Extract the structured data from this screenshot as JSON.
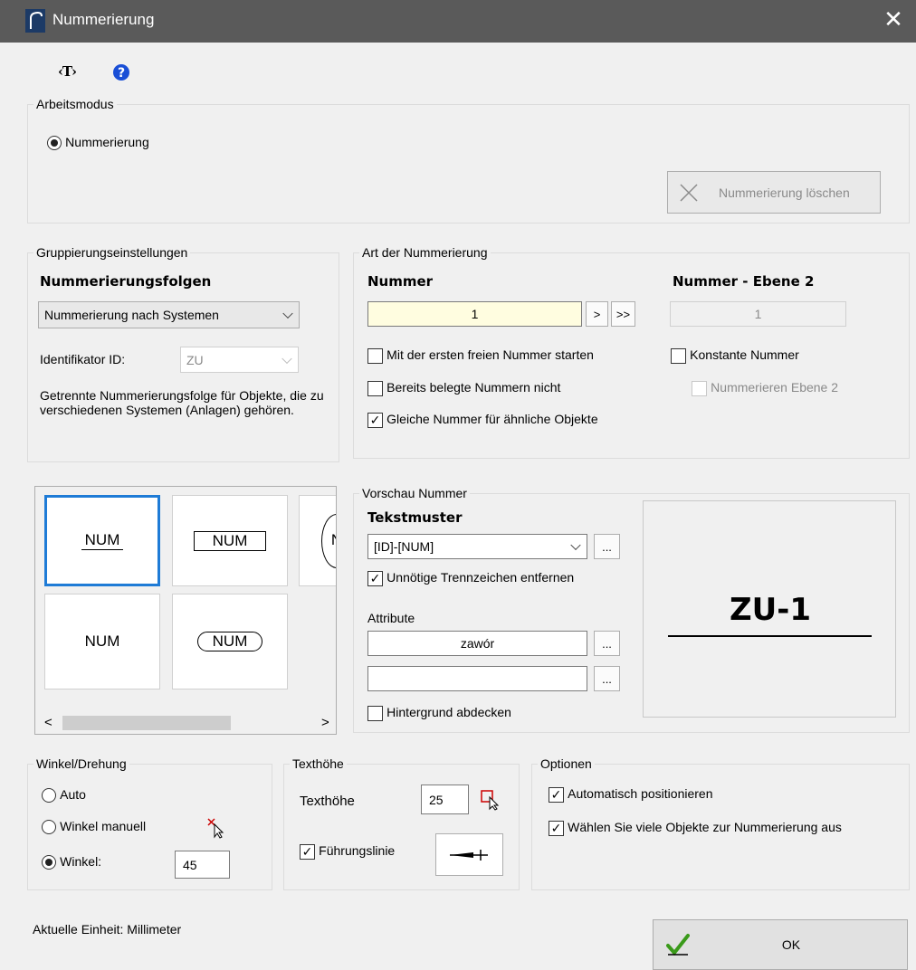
{
  "window": {
    "title": "Nummerierung",
    "close": "✕"
  },
  "toolbar": {
    "text_icon_label": "‹T›",
    "help_icon": "question-icon"
  },
  "arbeitsmodus": {
    "legend": "Arbeitsmodus",
    "radio_label": "Nummerierung",
    "delete_button": "Nummerierung löschen"
  },
  "gruppierung": {
    "legend": "Gruppierungseinstellungen",
    "folgen_label": "Nummerierungsfolgen",
    "folgen_value": "Nummerierung nach Systemen",
    "id_label": "Identifikator ID:",
    "id_value": "ZU",
    "description": "Getrennte Nummerierungsfolge für Objekte, die zu verschiedenen Systemen (Anlagen) gehören."
  },
  "art": {
    "legend": "Art der Nummerierung",
    "nummer_label": "Nummer",
    "nummer_value": "1",
    "next_button": ">",
    "last_button": ">>",
    "ebene2_label": "Nummer - Ebene 2",
    "ebene2_value": "1",
    "opt_first_free": "Mit der ersten freien Nummer starten",
    "opt_used": "Bereits belegte Nummern nicht",
    "opt_same": "Gleiche Nummer für ähnliche Objekte",
    "opt_constant": "Konstante Nummer",
    "opt_ebene2": "Nummerieren Ebene 2"
  },
  "styles": {
    "tiles": [
      "NUM",
      "NUM",
      "N",
      "NUM",
      "NUM"
    ],
    "scroll_left": "<",
    "scroll_right": ">"
  },
  "vorschau": {
    "legend": "Vorschau Nummer",
    "muster_label": "Tekstmuster",
    "muster_value": "[ID]-[NUM]",
    "more": "...",
    "opt_trenn": "Unnötige Trennzeichen entfernen",
    "attribute_label": "Attribute",
    "attribute_value": "zawór",
    "attribute2_value": "",
    "opt_hintergrund": "Hintergrund abdecken",
    "preview_text": "ZU-1"
  },
  "winkel": {
    "legend": "Winkel/Drehung",
    "auto": "Auto",
    "manuell": "Winkel manuell",
    "winkel": "Winkel:",
    "winkel_value": "45"
  },
  "texthoehe": {
    "legend": "Texthöhe",
    "label": "Texthöhe",
    "value": "25",
    "fuehrung": "Führungslinie"
  },
  "optionen": {
    "legend": "Optionen",
    "auto_pos": "Automatisch positionieren",
    "viele": "Wählen Sie viele Objekte zur Nummerierung aus"
  },
  "footer": {
    "unit": "Aktuelle Einheit: Millimeter",
    "ok": "OK"
  },
  "colors": {
    "titlebar": "#5a5a5a",
    "highlight_input": "#fffde0",
    "help_blue": "#1a4fd6",
    "tile_selected": "#1e7bd6"
  }
}
